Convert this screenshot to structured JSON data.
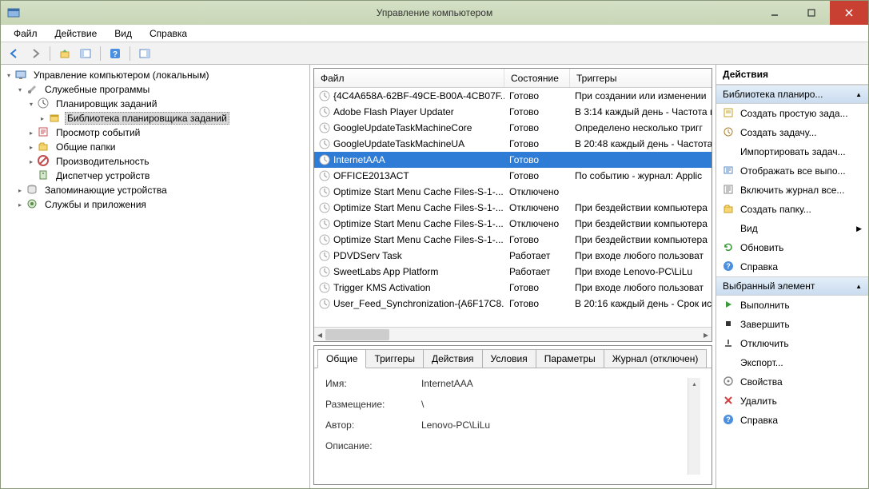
{
  "window": {
    "title": "Управление компьютером"
  },
  "menubar": [
    "Файл",
    "Действие",
    "Вид",
    "Справка"
  ],
  "tree": [
    {
      "indent": 0,
      "expander": "▾",
      "icon": "computer",
      "label": "Управление компьютером (локальным)"
    },
    {
      "indent": 1,
      "expander": "▾",
      "icon": "tools",
      "label": "Служебные программы"
    },
    {
      "indent": 2,
      "expander": "▾",
      "icon": "clock",
      "label": "Планировщик заданий"
    },
    {
      "indent": 3,
      "expander": "▸",
      "icon": "library",
      "label": "Библиотека планировщика заданий",
      "selected": true
    },
    {
      "indent": 2,
      "expander": "▸",
      "icon": "event",
      "label": "Просмотр событий"
    },
    {
      "indent": 2,
      "expander": "▸",
      "icon": "folder-share",
      "label": "Общие папки"
    },
    {
      "indent": 2,
      "expander": "▸",
      "icon": "perf",
      "label": "Производительность"
    },
    {
      "indent": 2,
      "expander": "",
      "icon": "device",
      "label": "Диспетчер устройств"
    },
    {
      "indent": 1,
      "expander": "▸",
      "icon": "storage",
      "label": "Запоминающие устройства"
    },
    {
      "indent": 1,
      "expander": "▸",
      "icon": "services",
      "label": "Службы и приложения"
    }
  ],
  "task_columns": {
    "file": "Файл",
    "state": "Состояние",
    "trigger": "Триггеры"
  },
  "tasks": [
    {
      "name": "{4C4A658A-62BF-49CE-B00A-4CB07F...",
      "state": "Готово",
      "trigger": "При создании или изменении"
    },
    {
      "name": "Adobe Flash Player Updater",
      "state": "Готово",
      "trigger": "В 3:14 каждый день - Частота п"
    },
    {
      "name": "GoogleUpdateTaskMachineCore",
      "state": "Готово",
      "trigger": "Определено несколько тригг"
    },
    {
      "name": "GoogleUpdateTaskMachineUA",
      "state": "Готово",
      "trigger": "В 20:48 каждый день - Частота"
    },
    {
      "name": "InternetAAA",
      "state": "Готово",
      "trigger": "",
      "selected": true
    },
    {
      "name": "OFFICE2013ACT",
      "state": "Готово",
      "trigger": "По событию - журнал: Applic"
    },
    {
      "name": "Optimize Start Menu Cache Files-S-1-...",
      "state": "Отключено",
      "trigger": ""
    },
    {
      "name": "Optimize Start Menu Cache Files-S-1-...",
      "state": "Отключено",
      "trigger": "При бездействии компьютера"
    },
    {
      "name": "Optimize Start Menu Cache Files-S-1-...",
      "state": "Отключено",
      "trigger": "При бездействии компьютера"
    },
    {
      "name": "Optimize Start Menu Cache Files-S-1-...",
      "state": "Готово",
      "trigger": "При бездействии компьютера"
    },
    {
      "name": "PDVDServ Task",
      "state": "Работает",
      "trigger": "При входе любого пользоват"
    },
    {
      "name": "SweetLabs App Platform",
      "state": "Работает",
      "trigger": "При входе Lenovo-PC\\LiLu"
    },
    {
      "name": "Trigger KMS Activation",
      "state": "Готово",
      "trigger": "При входе любого пользоват"
    },
    {
      "name": "User_Feed_Synchronization-{A6F17C8...",
      "state": "Готово",
      "trigger": "В 20:16 каждый день - Срок ис"
    }
  ],
  "detail_tabs": [
    "Общие",
    "Триггеры",
    "Действия",
    "Условия",
    "Параметры",
    "Журнал (отключен)"
  ],
  "details": {
    "name_label": "Имя:",
    "name_value": "InternetAAA",
    "location_label": "Размещение:",
    "location_value": "\\",
    "author_label": "Автор:",
    "author_value": "Lenovo-PC\\LiLu",
    "description_label": "Описание:"
  },
  "actions": {
    "header": "Действия",
    "section1": "Библиотека планиро...",
    "items1": [
      {
        "icon": "new-basic",
        "label": "Создать простую зада..."
      },
      {
        "icon": "new-task",
        "label": "Создать задачу..."
      },
      {
        "icon": "",
        "label": "Импортировать задач..."
      },
      {
        "icon": "show-all",
        "label": "Отображать все выпо..."
      },
      {
        "icon": "enable-log",
        "label": "Включить журнал все..."
      },
      {
        "icon": "new-folder",
        "label": "Создать папку..."
      },
      {
        "icon": "",
        "label": "Вид",
        "chev": true
      },
      {
        "icon": "refresh",
        "label": "Обновить"
      },
      {
        "icon": "help",
        "label": "Справка"
      }
    ],
    "section2": "Выбранный элемент",
    "items2": [
      {
        "icon": "run",
        "label": "Выполнить"
      },
      {
        "icon": "stop",
        "label": "Завершить"
      },
      {
        "icon": "disable",
        "label": "Отключить"
      },
      {
        "icon": "",
        "label": "Экспорт..."
      },
      {
        "icon": "props",
        "label": "Свойства"
      },
      {
        "icon": "delete",
        "label": "Удалить"
      },
      {
        "icon": "help",
        "label": "Справка"
      }
    ]
  }
}
